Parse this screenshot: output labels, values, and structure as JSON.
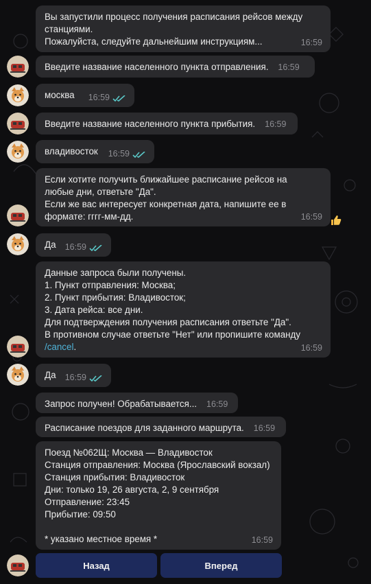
{
  "messages": [
    {
      "id": "m1",
      "text": "Вы запустили процесс получения расписания рейсов между\nстанциями.\nПожалуйста, следуйте дальнейшим инструкциям...",
      "time": "16:59"
    },
    {
      "id": "m2",
      "text": "Введите название населенного пункта отправления.",
      "time": "16:59"
    },
    {
      "id": "m3",
      "text": "москва",
      "time": "16:59"
    },
    {
      "id": "m4",
      "text": "Введите название населенного пункта прибытия.",
      "time": "16:59"
    },
    {
      "id": "m5",
      "text": "владивосток",
      "time": "16:59"
    },
    {
      "id": "m6",
      "text": "Если хотите получить ближайшее расписание рейсов на\nлюбые дни, ответьте \"Да\".\nЕсли же вас интересует конкретная дата, напишите ее в\nформате: гггг-мм-дд.",
      "time": "16:59"
    },
    {
      "id": "m7",
      "text": "Да",
      "time": "16:59"
    },
    {
      "id": "m8",
      "text": "Данные запроса были получены.\n1. Пункт отправления: Москва;\n2. Пункт прибытия: Владивосток;\n3. Дата рейса: все дни.\nДля подтверждения получения расписания ответьте \"Да\".\nВ противном случае ответьте \"Нет\" или пропишите команду",
      "link": "/cancel",
      "after": ".",
      "time": "16:59"
    },
    {
      "id": "m9",
      "text": "Да",
      "time": "16:59"
    },
    {
      "id": "m10",
      "text": "Запрос получен! Обрабатывается...",
      "time": "16:59"
    },
    {
      "id": "m11",
      "text": "Расписание поездов для заданного маршрута.",
      "time": "16:59"
    },
    {
      "id": "m12",
      "text": "Поезд №062Щ: Москва — Владивосток\nСтанция отправления: Москва (Ярославский вокзал)\nСтанция прибытия: Владивосток\nДни: только 19, 26 августа, 2, 9 сентября\nОтправление: 23:45\nПрибытие: 09:50\n\n* указано местное время *",
      "time": "16:59"
    }
  ],
  "keyboard": {
    "back_label": "Назад",
    "forward_label": "Вперед"
  },
  "colors": {
    "background": "#0e0e10",
    "bubble": "#2a2a2d",
    "link": "#4fb3d8",
    "checks": "#5ac8c8",
    "keyboard_button": "#1d2a5c"
  },
  "icons": {
    "bot_avatar": "train-avatar",
    "user_avatar": "shiba-dog-avatar",
    "reaction": "thumbs-up-icon",
    "read_status": "double-check-icon"
  }
}
